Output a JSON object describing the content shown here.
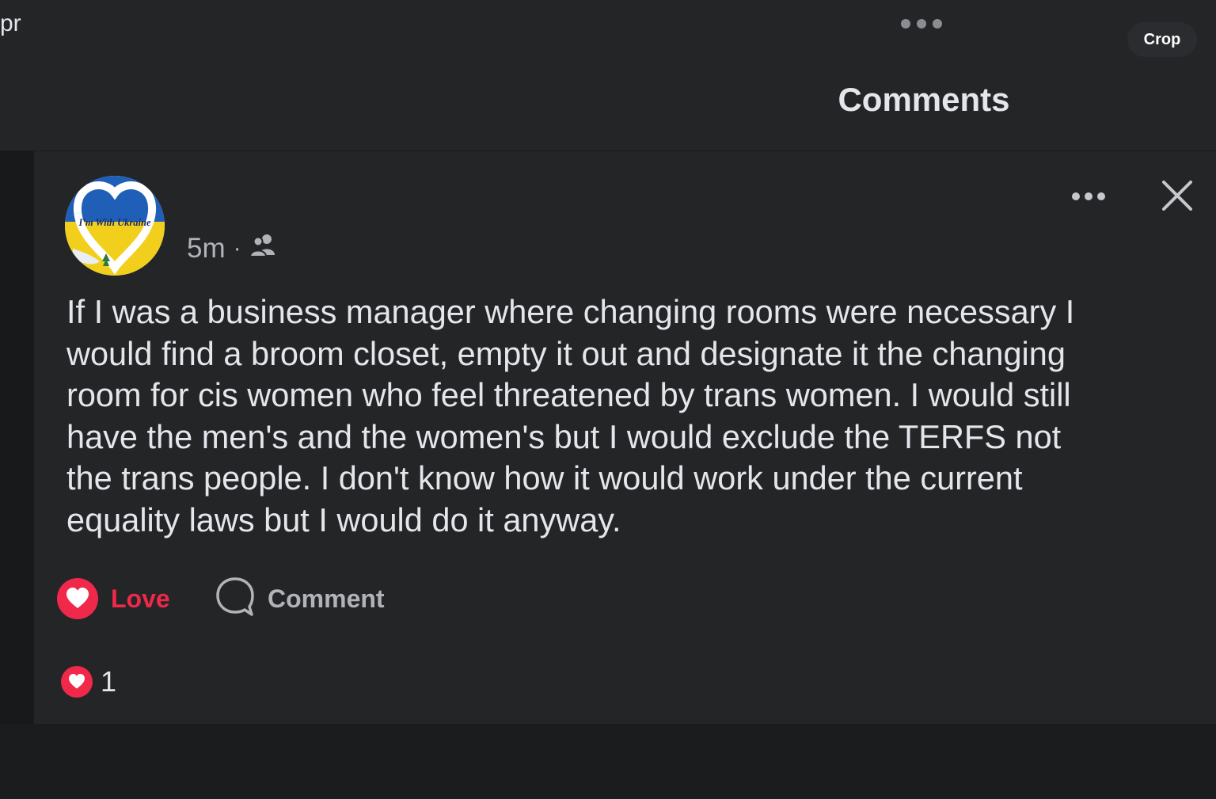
{
  "corner_fragment": "pr",
  "header": {
    "more_icon": "more-horizontal-icon",
    "crop_label": "Crop",
    "title": "Comments"
  },
  "post": {
    "author_name": "",
    "avatar_text": "I'm With Ukraine",
    "time": "5m",
    "separator": "·",
    "audience_icon": "friends-icon",
    "text": "If I was a business manager where changing rooms were necessary I\nwould find a broom closet, empty it out and designate it the changing\nroom for cis women who feel threatened by trans women. I would still\nhave the men's and the women's but I would exclude the TERFS not\nthe trans people. I don't know how it would work under the current\nequality laws but I would do it anyway.",
    "actions": {
      "love_label": "Love",
      "comment_label": "Comment"
    },
    "reactions": {
      "count": "1",
      "icon": "heart-icon"
    }
  },
  "colors": {
    "background": "#242527",
    "love_red": "#f0284a",
    "text_primary": "#e4e6eb",
    "text_secondary": "#b0b3b8"
  }
}
